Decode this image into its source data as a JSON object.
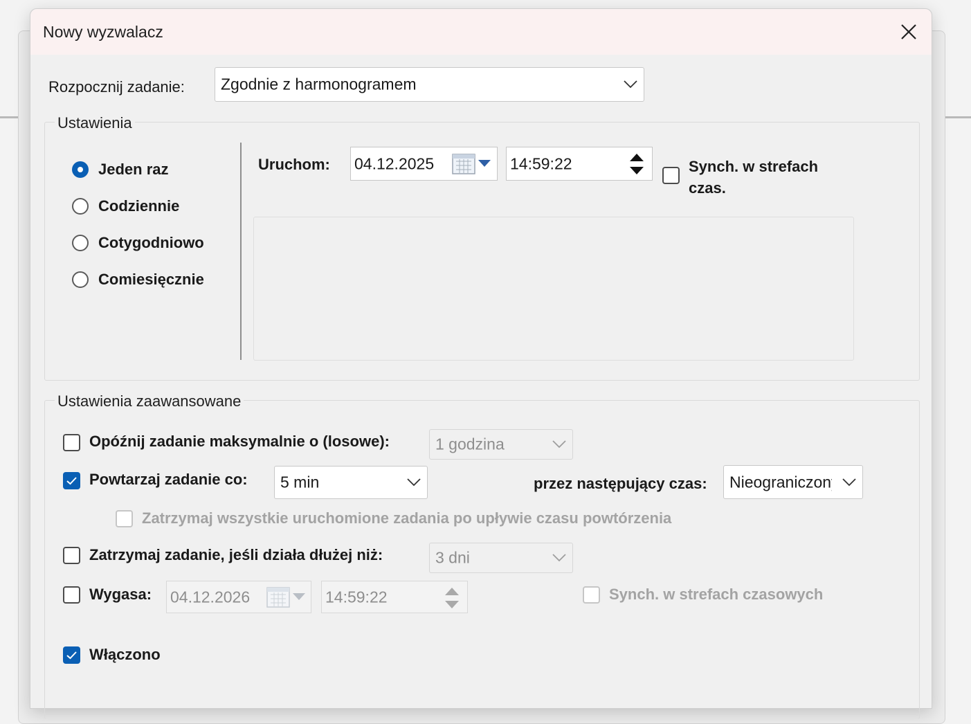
{
  "dialog": {
    "title": "Nowy wyzwalacz",
    "close_icon": "close-icon"
  },
  "start_task": {
    "label": "Rozpocznij zadanie:",
    "value": "Zgodnie z harmonogramem"
  },
  "settings": {
    "title": "Ustawienia",
    "schedule_options": [
      {
        "label": "Jeden raz",
        "selected": true
      },
      {
        "label": "Codziennie",
        "selected": false
      },
      {
        "label": "Cotygodniowo",
        "selected": false
      },
      {
        "label": "Comiesięcznie",
        "selected": false
      }
    ],
    "start": {
      "label": "Uruchom:",
      "date": "04.12.2025",
      "time": "14:59:22",
      "sync_label_line1": "Synch. w strefach",
      "sync_label_line2": "czas.",
      "sync_checked": false
    }
  },
  "advanced": {
    "title": "Ustawienia zaawansowane",
    "delay": {
      "label": "Opóźnij zadanie maksymalnie o (losowe):",
      "checked": false,
      "value": "1 godzina"
    },
    "repeat": {
      "label": "Powtarzaj zadanie co:",
      "checked": true,
      "value": "5 min",
      "duration_label": "przez następujący czas:",
      "duration_value": "Nieograniczony"
    },
    "stop_all": {
      "label": "Zatrzymaj wszystkie uruchomione zadania po upływie czasu powtórzenia",
      "checked": false
    },
    "stop_longer": {
      "label": "Zatrzymaj zadanie, jeśli działa dłużej niż:",
      "checked": false,
      "value": "3 dni"
    },
    "expire": {
      "label": "Wygasa:",
      "checked": false,
      "date": "04.12.2026",
      "time": "14:59:22",
      "sync_label": "Synch. w strefach czasowych",
      "sync_checked": false
    },
    "enabled": {
      "label": "Włączono",
      "checked": true
    }
  },
  "colors": {
    "accent": "#0a5fb4",
    "title_bar": "#fbf1f1",
    "dialog_bg": "#f0f0f0",
    "disabled_text": "#a3a3a3"
  }
}
